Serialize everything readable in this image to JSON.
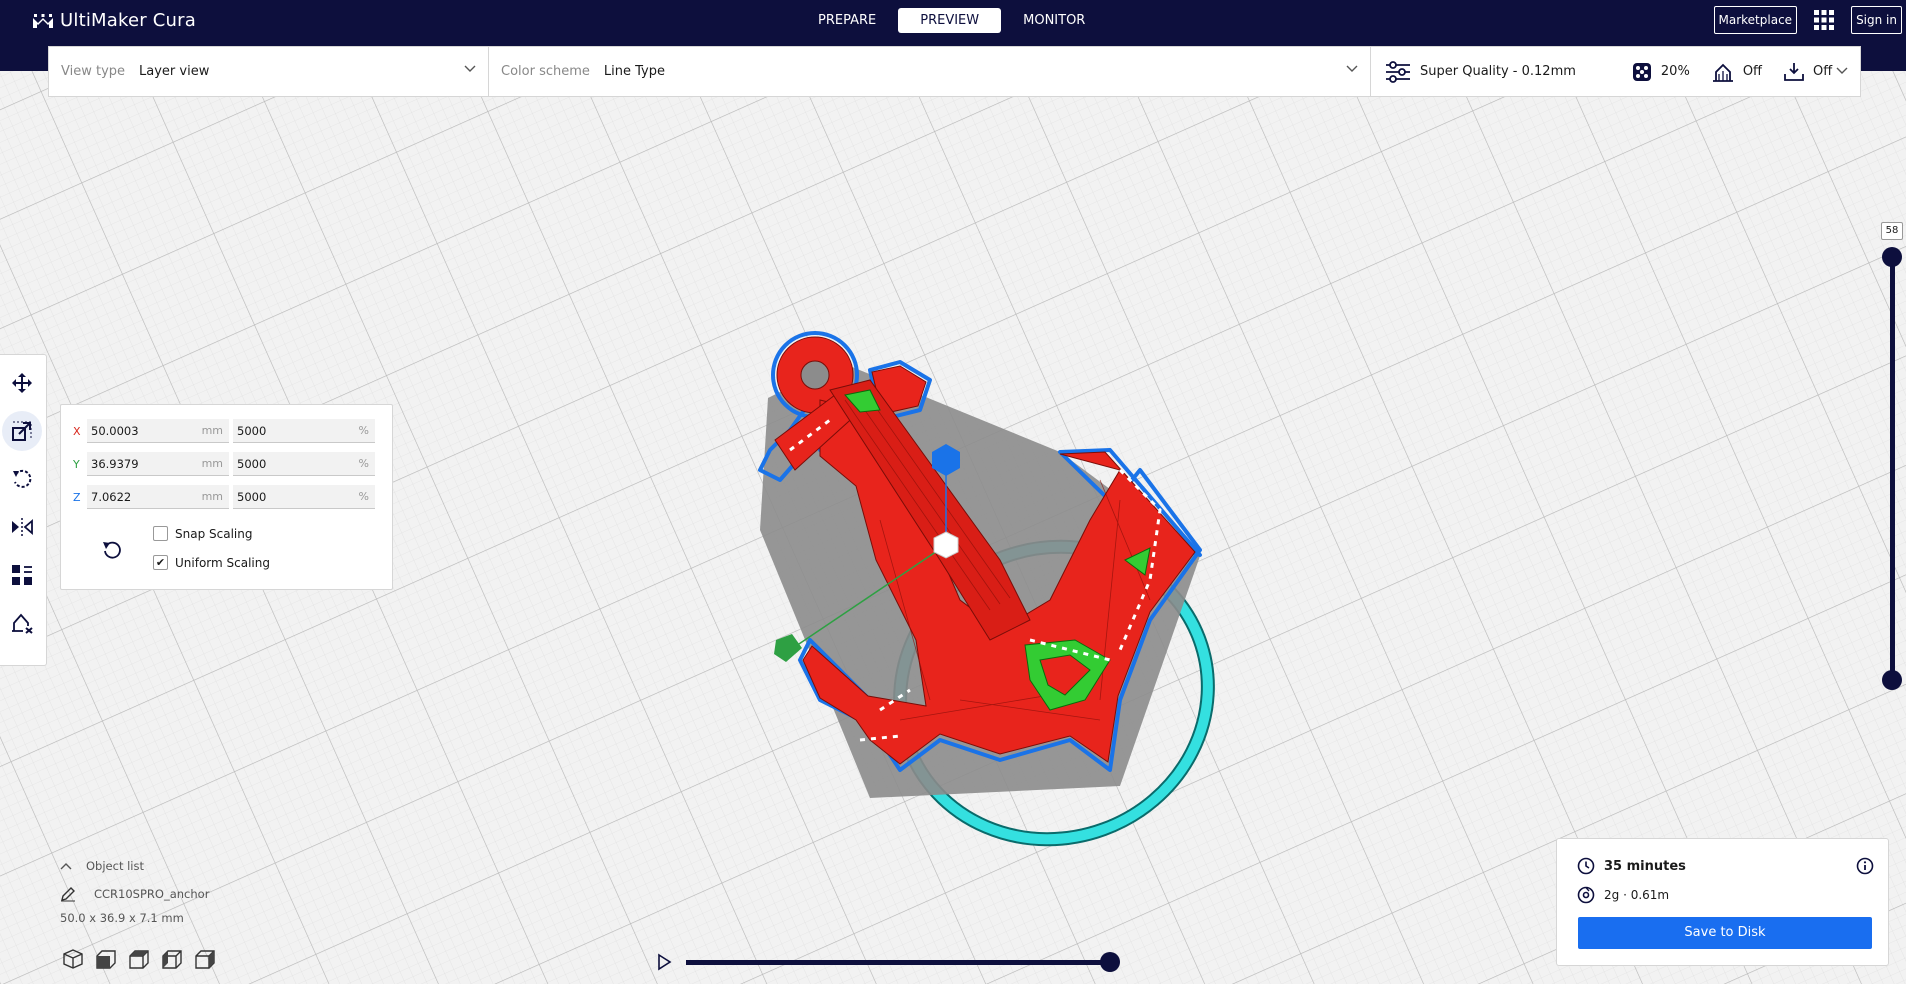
{
  "app": {
    "title": "UltiMaker Cura"
  },
  "stages": [
    "PREPARE",
    "PREVIEW",
    "MONITOR"
  ],
  "header": {
    "marketplace": "Marketplace",
    "sign_in": "Sign in"
  },
  "view": {
    "view_type_label": "View type",
    "view_type_value": "Layer view",
    "color_scheme_label": "Color scheme",
    "color_scheme_value": "Line Type"
  },
  "print_setup": {
    "profile": "Super Quality - 0.12mm",
    "infill": "20%",
    "support": "Off",
    "adhesion": "Off"
  },
  "scale_tool": {
    "x": {
      "axis": "X",
      "mm": "50.0003",
      "unit_mm": "mm",
      "percent": "5000",
      "unit_pct": "%"
    },
    "y": {
      "axis": "Y",
      "mm": "36.9379",
      "unit_mm": "mm",
      "percent": "5000",
      "unit_pct": "%"
    },
    "z": {
      "axis": "Z",
      "mm": "7.0622",
      "unit_mm": "mm",
      "percent": "5000",
      "unit_pct": "%"
    },
    "snap_scaling": "Snap Scaling",
    "uniform_scaling": "Uniform Scaling",
    "snap_checked": false,
    "uniform_checked": true
  },
  "layer_slider": {
    "current": "58"
  },
  "object_list": {
    "header": "Object list",
    "object_name": "CCR10SPRO_anchor",
    "dimensions": "50.0 x 36.9 x 7.1 mm"
  },
  "summary": {
    "time": "35 minutes",
    "material": "2g · 0.61m",
    "save_label": "Save to Disk"
  },
  "colors": {
    "header_bg": "#0d0f3d",
    "accent_blue": "#196ef0",
    "model_red": "#e8241c",
    "skirt_cyan": "#34e0e0",
    "infill_green": "#33cc33"
  }
}
